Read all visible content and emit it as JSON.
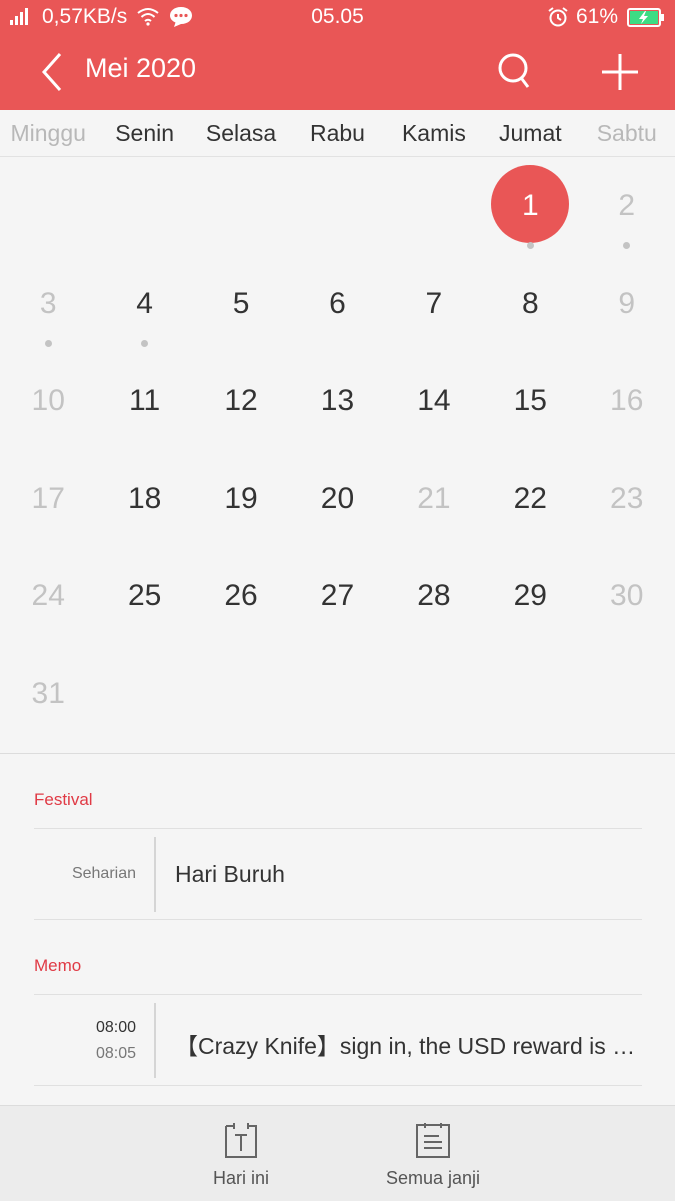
{
  "status_bar": {
    "network_speed": "0,57KB/s",
    "time": "05.05",
    "battery": "61%"
  },
  "header": {
    "title": "Mei 2020"
  },
  "weekdays": [
    "Minggu",
    "Senin",
    "Selasa",
    "Rabu",
    "Kamis",
    "Jumat",
    "Sabtu"
  ],
  "calendar": {
    "weeks": [
      [
        {
          "d": ""
        },
        {
          "d": ""
        },
        {
          "d": ""
        },
        {
          "d": ""
        },
        {
          "d": ""
        },
        {
          "d": "1"
        },
        {
          "d": "2"
        }
      ],
      [
        {
          "d": "3"
        },
        {
          "d": "4"
        },
        {
          "d": "5"
        },
        {
          "d": "6"
        },
        {
          "d": "7"
        },
        {
          "d": "8"
        },
        {
          "d": "9"
        }
      ],
      [
        {
          "d": "10"
        },
        {
          "d": "11"
        },
        {
          "d": "12"
        },
        {
          "d": "13"
        },
        {
          "d": "14"
        },
        {
          "d": "15"
        },
        {
          "d": "16"
        }
      ],
      [
        {
          "d": "17"
        },
        {
          "d": "18"
        },
        {
          "d": "19"
        },
        {
          "d": "20"
        },
        {
          "d": "21"
        },
        {
          "d": "22"
        },
        {
          "d": "23"
        }
      ],
      [
        {
          "d": "24"
        },
        {
          "d": "25"
        },
        {
          "d": "26"
        },
        {
          "d": "27"
        },
        {
          "d": "28"
        },
        {
          "d": "29"
        },
        {
          "d": "30"
        }
      ],
      [
        {
          "d": "31"
        },
        {
          "d": ""
        },
        {
          "d": ""
        },
        {
          "d": ""
        },
        {
          "d": ""
        },
        {
          "d": ""
        },
        {
          "d": ""
        }
      ]
    ],
    "today": "1",
    "dimmed_days": [
      "2",
      "3",
      "9",
      "10",
      "16",
      "17",
      "21",
      "23",
      "24",
      "30",
      "31"
    ],
    "days_with_events": [
      "1",
      "2",
      "3",
      "4"
    ]
  },
  "festival": {
    "label": "Festival",
    "time": "Seharian",
    "title": "Hari Buruh"
  },
  "memo": {
    "label": "Memo",
    "start": "08:00",
    "end": "08:05",
    "title": "【Crazy Knife】sign in, the USD reward is waiting for you!"
  },
  "bottom_nav": {
    "today_label": "Hari ini",
    "all_label": "Semua janji"
  },
  "colors": {
    "accent": "#e95656",
    "section_label": "#e03a45"
  }
}
